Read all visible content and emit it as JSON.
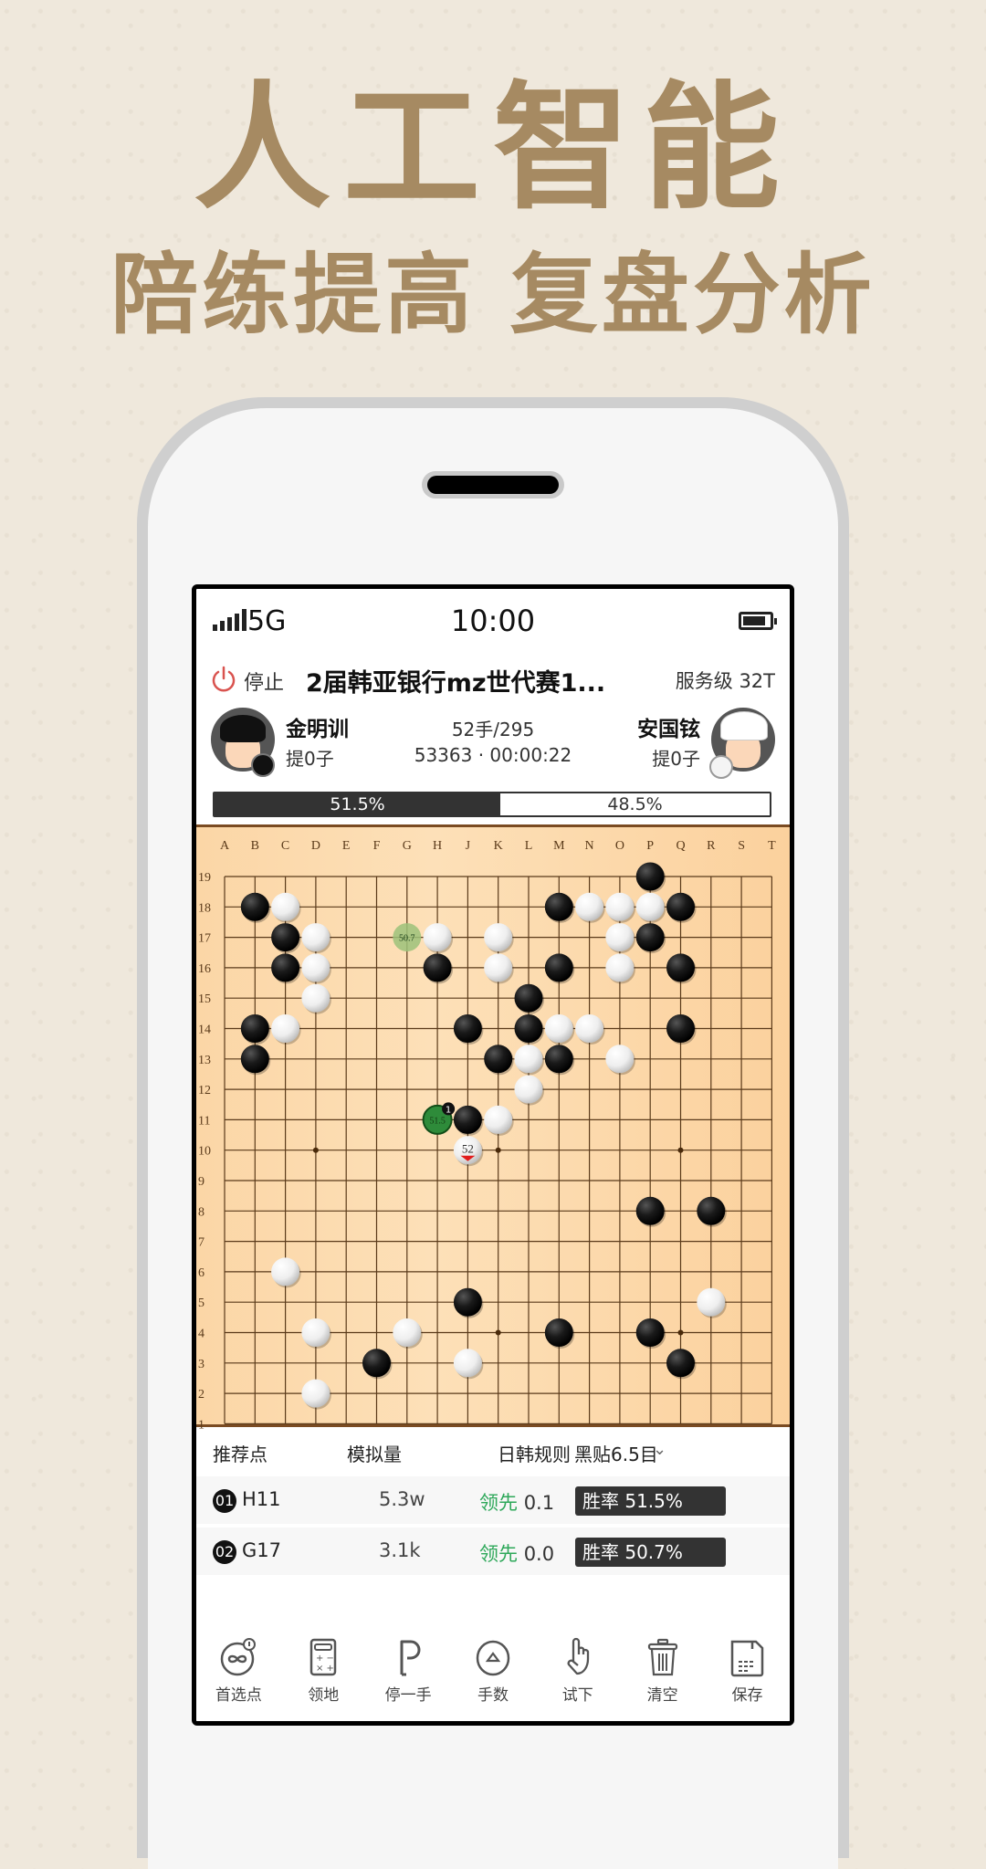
{
  "promo": {
    "headline": "人工智能",
    "subheadline": "陪练提高 复盘分析",
    "color": "#a68a62"
  },
  "status_bar": {
    "network": "5G",
    "time": "10:00"
  },
  "title_bar": {
    "stop_label": "停止",
    "game_title": "2届韩亚银行mz世代赛1...",
    "service_level": "服务级 32T"
  },
  "players": {
    "black": {
      "name": "金明训",
      "captures": "提0子"
    },
    "white": {
      "name": "安国铉",
      "captures": "提0子"
    },
    "move_count": "52手/295",
    "playouts_time": "53363 · 00:00:22"
  },
  "win_rate": {
    "black_label": "51.5%",
    "white_label": "48.5%",
    "black_fraction": 0.515
  },
  "board": {
    "size": 19,
    "columns": [
      "A",
      "B",
      "C",
      "D",
      "E",
      "F",
      "G",
      "H",
      "J",
      "K",
      "L",
      "M",
      "N",
      "O",
      "P",
      "Q",
      "R",
      "S",
      "T"
    ],
    "rows": [
      "19",
      "18",
      "17",
      "16",
      "15",
      "14",
      "13",
      "12",
      "11",
      "10",
      "9",
      "8",
      "7",
      "6",
      "5",
      "4",
      "3",
      "2",
      "1"
    ],
    "star_points": [
      "D10",
      "K10",
      "Q10",
      "K4",
      "Q4"
    ],
    "black_stones": [
      "P19",
      "B18",
      "M18",
      "Q18",
      "C17",
      "P17",
      "C16",
      "H16",
      "M16",
      "Q16",
      "L15",
      "B14",
      "J14",
      "L14",
      "Q14",
      "B13",
      "K13",
      "M13",
      "J11",
      "P8",
      "R8",
      "J5",
      "M4",
      "P4",
      "F3",
      "Q3"
    ],
    "white_stones": [
      "C18",
      "N18",
      "O18",
      "P18",
      "D17",
      "H17",
      "K17",
      "O17",
      "D16",
      "K16",
      "O16",
      "D15",
      "C14",
      "M14",
      "N14",
      "L13",
      "O13",
      "L12",
      "K11",
      "J10",
      "C6",
      "R5",
      "D4",
      "G4",
      "J3",
      "D2"
    ],
    "last_move": {
      "point": "J10",
      "number": "52"
    },
    "suggestions": [
      {
        "point": "H11",
        "label": "51.5",
        "rank": "1",
        "primary": true
      },
      {
        "point": "G17",
        "label": "50.7",
        "rank": "2",
        "primary": false
      }
    ]
  },
  "analysis": {
    "header": {
      "point_label": "推荐点",
      "sims_label": "模拟量",
      "rules_label": "日韩规则",
      "komi_label": "黑贴6.5目"
    },
    "rows": [
      {
        "rank": "01",
        "point": "H11",
        "sims": "5.3w",
        "lead_label": "领先",
        "lead_value": "0.1",
        "winrate": "胜率 51.5%"
      },
      {
        "rank": "02",
        "point": "G17",
        "sims": "3.1k",
        "lead_label": "领先",
        "lead_value": "0.0",
        "winrate": "胜率 50.7%"
      }
    ]
  },
  "toolbar": [
    {
      "label": "首选点",
      "icon": "infinity-icon"
    },
    {
      "label": "领地",
      "icon": "calculator-icon"
    },
    {
      "label": "停一手",
      "icon": "pass-icon"
    },
    {
      "label": "手数",
      "icon": "move-number-icon"
    },
    {
      "label": "试下",
      "icon": "hand-pointer-icon"
    },
    {
      "label": "清空",
      "icon": "trash-icon"
    },
    {
      "label": "保存",
      "icon": "save-icon"
    }
  ]
}
